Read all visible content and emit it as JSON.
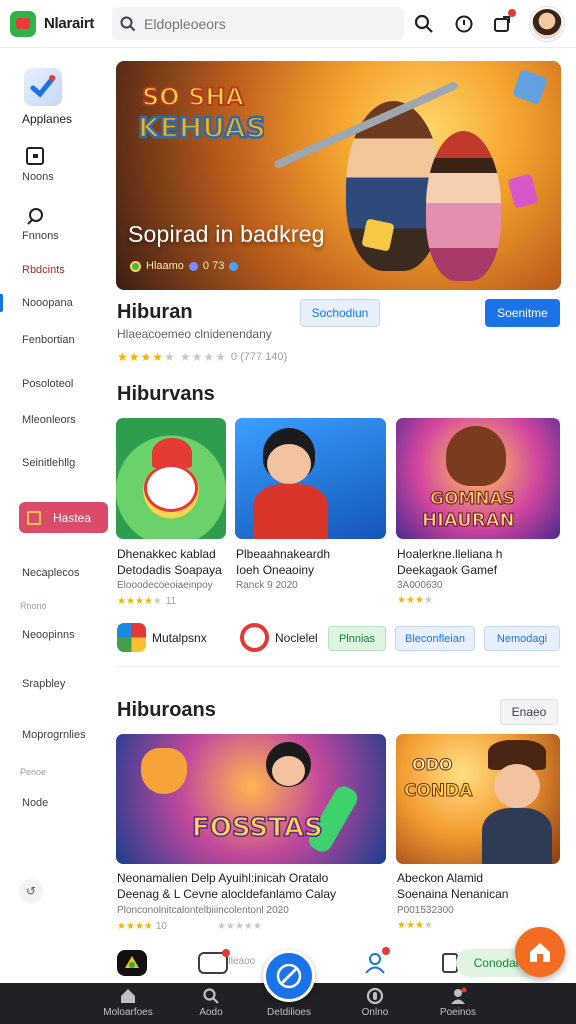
{
  "header": {
    "brand": "Nlarairt",
    "search_placeholder": "Eldopleoeors",
    "icons": [
      "search-icon",
      "alarm-icon",
      "share-icon",
      "avatar"
    ],
    "accent": "#1a73e8"
  },
  "sidebar": {
    "app_label": "Applanes",
    "items": [
      "Noons",
      "Fnnons",
      "Rbdcints",
      "Nooopana",
      "Fenbortian",
      "Posoloteol",
      "Mleonleors",
      "Seinitlehllg"
    ],
    "active_pill": "Hastea",
    "items2": [
      "Necaplecos",
      "Neoopinns",
      "Srapbley",
      "Moprogrnlies",
      "Node"
    ],
    "faint": [
      "Rnono",
      "Penoe"
    ]
  },
  "hero": {
    "logo_line1": "SO SHA",
    "logo_line2": "KEHUAS",
    "title": "Sopirad in badkreg",
    "meta_brand": "Hlaamo",
    "meta_code": "0 73"
  },
  "app": {
    "title": "Hiburan",
    "subtitle": "Hlaeacoemeo clnidenendany",
    "rating_text": "0 (777 140)",
    "stars_on": 4,
    "stars_off": 5,
    "btn_secondary": "Sochodiun",
    "btn_primary": "Soenitme"
  },
  "section1": {
    "title": "Hiburvans",
    "cards": [
      {
        "title_l1": "Dhenakkec kablad",
        "title_l2": "Detodadis Soapaya",
        "sub": "Elooodecoeoiaeinpoy",
        "stars_on": 4,
        "rating": "11"
      },
      {
        "title_l1": "Plbeaahnakeardh",
        "title_l2": "Ioeh Oneaoiny",
        "sub": "Ranck 9 2020",
        "stars_on": 0,
        "rating": ""
      },
      {
        "title_l1": "Hoalerkne.lleliana h",
        "title_l2": "Deekagaok Gamef",
        "sub": "3A000630",
        "stars_on": 3,
        "rating": ""
      }
    ],
    "card3_logo1": "GOMNAS",
    "card3_logo2": "HIAURAN",
    "mini_apps": [
      "Mutalpsnx",
      "Noclelel"
    ],
    "chips": [
      "Plnnias",
      "Bleconfleian",
      "Nemodagi"
    ]
  },
  "section2": {
    "title": "Hiburoans",
    "btn": "Enaeo",
    "cards": [
      {
        "title_l1": "Neonamalien Delp Ayuihl:inicah Oratalo",
        "title_l2": "Deenag & L Cevne alocldefanlamo Calay",
        "sub": "Plonconolnitcalontelbiiincolentonl 2020",
        "stars_on": 4,
        "rating": "10"
      },
      {
        "title_l1": "Abeckon Alamid",
        "title_l2": "Soenaina Nenanican",
        "sub": "P001532300",
        "stars_on": 3,
        "rating": ""
      }
    ],
    "card1_logo": "FOSSTAS",
    "card2_logo1": "ODO",
    "card2_logo2": "CONDA"
  },
  "dock": {
    "label": "Ileaoo",
    "pill": "Conodan"
  },
  "bottom_nav": [
    "Moloarfoes",
    "Aodo",
    "Detdilioes",
    "Onlno",
    "Poeinos"
  ]
}
